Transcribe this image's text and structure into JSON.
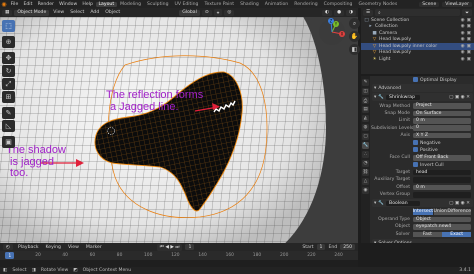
{
  "menubar": {
    "items": [
      "File",
      "Edit",
      "Render",
      "Window",
      "Help"
    ],
    "workspaces": [
      "Layout",
      "Modeling",
      "Sculpting",
      "UV Editing",
      "Texture Paint",
      "Shading",
      "Animation",
      "Rendering",
      "Compositing",
      "Geometry Nodes"
    ],
    "active_workspace": "Layout",
    "scene": "Scene",
    "view_layer": "ViewLayer"
  },
  "viewport_header": {
    "mode": "Object Mode",
    "menus": [
      "View",
      "Select",
      "Add",
      "Object"
    ],
    "orientation": "Global"
  },
  "annotations": {
    "reflection": [
      "The reflection forms",
      "a Jagged line."
    ],
    "shadow": [
      "The shadow",
      "is jagged",
      "too."
    ]
  },
  "gizmo": {
    "x": "X",
    "y": "Y",
    "z": "Z"
  },
  "timeline": {
    "menus": [
      "Playback",
      "Keying",
      "View",
      "Marker"
    ],
    "current_frame": "1",
    "start_label": "Start",
    "start": "1",
    "end_label": "End",
    "end": "250",
    "ticks": [
      "0",
      "20",
      "40",
      "60",
      "80",
      "100",
      "120",
      "140",
      "160",
      "180",
      "200",
      "220",
      "240"
    ]
  },
  "statusbar": {
    "items": [
      "Select",
      "Rotate View",
      "Object Context Menu"
    ],
    "version": "3.4.1"
  },
  "outliner": {
    "title": "Scene Collection",
    "rows": [
      {
        "icon": "□",
        "label": "Scene Collection",
        "selected": false,
        "indent": 0
      },
      {
        "icon": "▸",
        "label": "Collection",
        "selected": false,
        "indent": 1
      },
      {
        "icon": "■",
        "label": "Camera",
        "selected": false,
        "indent": 2
      },
      {
        "icon": "▽",
        "label": "Head low.poly",
        "selected": false,
        "indent": 2
      },
      {
        "icon": "▽",
        "label": "Head low.poly inner color",
        "selected": true,
        "indent": 2
      },
      {
        "icon": "▽",
        "label": "Head low.poly",
        "selected": false,
        "indent": 2
      },
      {
        "icon": "☀",
        "label": "Light",
        "selected": false,
        "indent": 2
      }
    ]
  },
  "properties": {
    "rows": [
      {
        "kind": "check",
        "label": "",
        "value": "Optimal Display"
      },
      {
        "kind": "section",
        "label": "Advanced"
      },
      {
        "kind": "modifier",
        "label": "Shrinkwrap"
      },
      {
        "kind": "field",
        "label": "Wrap Method",
        "value": "Project"
      },
      {
        "kind": "field",
        "label": "Snap Mode",
        "value": "On Surface"
      },
      {
        "kind": "field",
        "label": "Limit",
        "value": "0 m"
      },
      {
        "kind": "field",
        "label": "Subdivision Levels",
        "value": "0"
      },
      {
        "kind": "field",
        "label": "Axis",
        "value": "X   Y   Z"
      },
      {
        "kind": "check",
        "label": "",
        "value": "Negative"
      },
      {
        "kind": "check",
        "label": "",
        "value": "Positive"
      },
      {
        "kind": "field",
        "label": "Face Cull",
        "value": "Off   Front   Back"
      },
      {
        "kind": "check",
        "label": "",
        "value": "Invert Cull"
      },
      {
        "kind": "field",
        "label": "Target",
        "value": "head"
      },
      {
        "kind": "field",
        "label": "Auxiliary Target",
        "value": ""
      },
      {
        "kind": "field",
        "label": "Offset",
        "value": "0 m"
      },
      {
        "kind": "field",
        "label": "Vertex Group",
        "value": ""
      },
      {
        "kind": "modifier",
        "label": "Boolean"
      },
      {
        "kind": "segmented",
        "label": "",
        "options": [
          "Intersect",
          "Union",
          "Difference"
        ],
        "active": 0
      },
      {
        "kind": "field",
        "label": "Operand Type",
        "value": "Object"
      },
      {
        "kind": "field",
        "label": "Object",
        "value": "eyepatch.new4"
      },
      {
        "kind": "segmented",
        "label": "Solver",
        "options": [
          "Fast",
          "Exact"
        ],
        "active": 1
      },
      {
        "kind": "section",
        "label": "Solver Options"
      }
    ]
  },
  "colors": {
    "accent": "#4772b3",
    "annotation": "#a020c8",
    "arrow": "#e0203a",
    "selection": "#e87d0d"
  }
}
